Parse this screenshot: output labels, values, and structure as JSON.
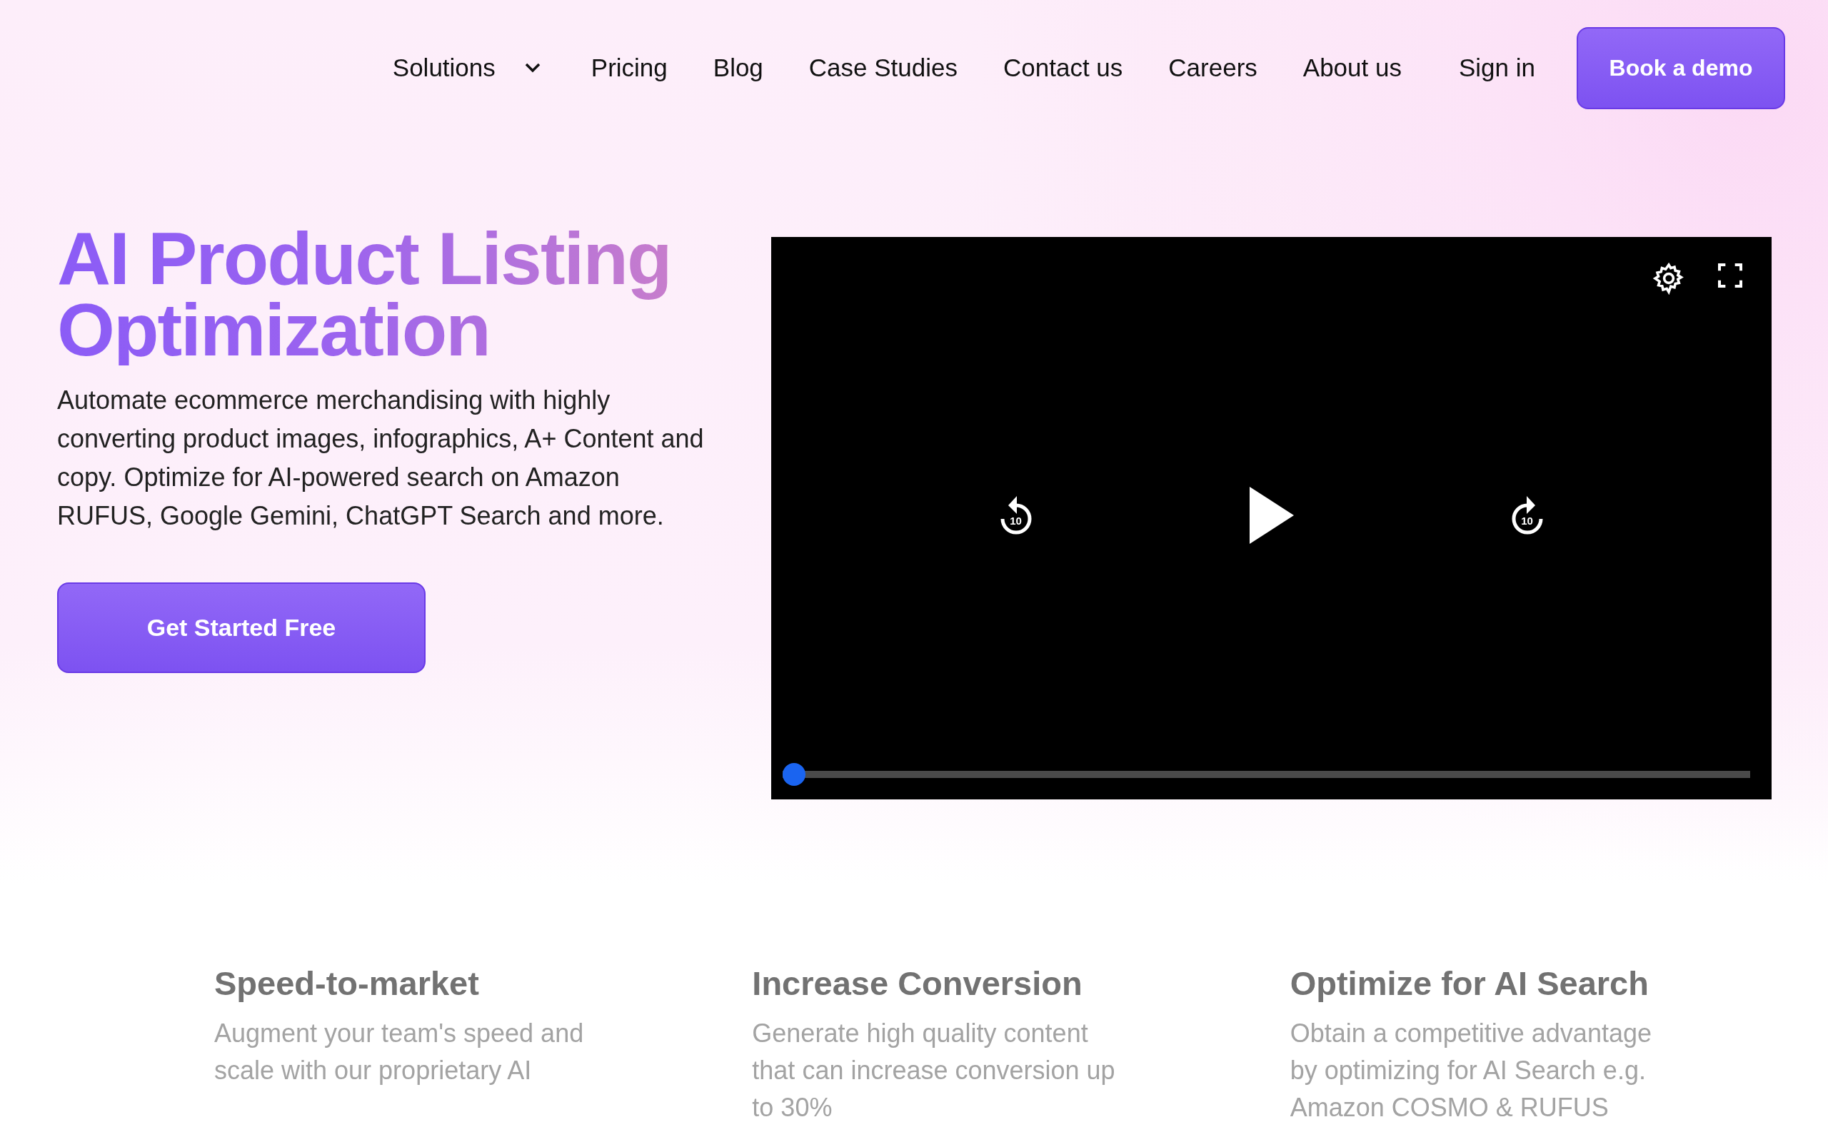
{
  "nav": {
    "items": [
      {
        "label": "Solutions",
        "kind": "dropdown"
      },
      {
        "label": "Pricing",
        "kind": "link"
      },
      {
        "label": "Blog",
        "kind": "link"
      },
      {
        "label": "Case Studies",
        "kind": "link"
      },
      {
        "label": "Contact us",
        "kind": "link"
      },
      {
        "label": "Careers",
        "kind": "link"
      },
      {
        "label": "About us",
        "kind": "link"
      }
    ],
    "sign_in": "Sign in",
    "cta": "Book a demo"
  },
  "hero": {
    "title_lines": [
      "AI Product Listing",
      "Optimization"
    ],
    "description": "Automate ecommerce merchandising with highly converting product images, infographics, A+ Content and copy. Optimize for AI-powered search on Amazon RUFUS, Google Gemini, ChatGPT Search and more.",
    "button": "Get Started Free"
  },
  "video": {
    "rewind_label": "10",
    "forward_label": "10",
    "progress": {
      "level": 0
    }
  },
  "features": [
    {
      "title": "Speed-to-market",
      "text": "Augment your team's speed and scale with our proprietary AI"
    },
    {
      "title": "Increase Conversion",
      "text": "Generate high quality content that can increase conversion up to 30%"
    },
    {
      "title": "Optimize for AI Search",
      "text": "Obtain a competitive advantage by optimizing for AI Search e.g. Amazon COSMO & RUFUS"
    }
  ]
}
